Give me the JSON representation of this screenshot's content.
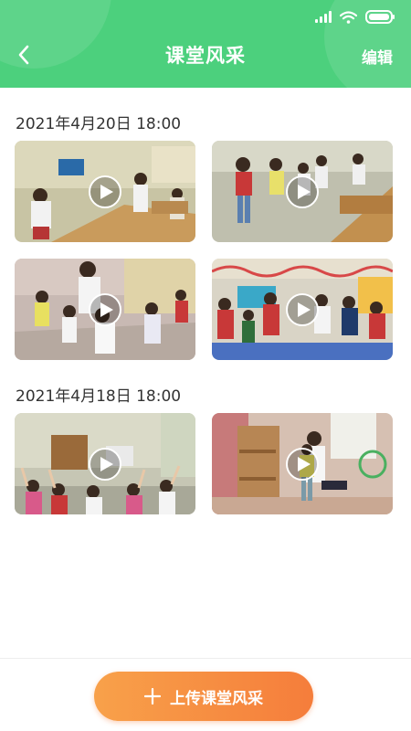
{
  "header": {
    "title": "课堂风采",
    "edit_label": "编辑",
    "back_icon": "chevron-left-icon",
    "color": "#4cd07d"
  },
  "status_bar": {
    "icons": [
      "signal-icon",
      "wifi-icon",
      "battery-icon"
    ]
  },
  "groups": [
    {
      "date": "2021年4月20日 18:00",
      "videos": [
        {
          "thumbnail": "classroom-tables-video-thumbnail"
        },
        {
          "thumbnail": "children-dancing-video-thumbnail"
        },
        {
          "thumbnail": "teacher-with-children-video-thumbnail"
        },
        {
          "thumbnail": "classroom-tv-video-thumbnail"
        }
      ]
    },
    {
      "date": "2021年4月18日  18:00",
      "videos": [
        {
          "thumbnail": "children-raising-hands-video-thumbnail"
        },
        {
          "thumbnail": "teacher-kneeling-video-thumbnail"
        }
      ]
    }
  ],
  "upload_button": {
    "label": "上传课堂风采",
    "icon": "plus-icon",
    "color_start": "#f8a14a",
    "color_end": "#f57d3b"
  }
}
